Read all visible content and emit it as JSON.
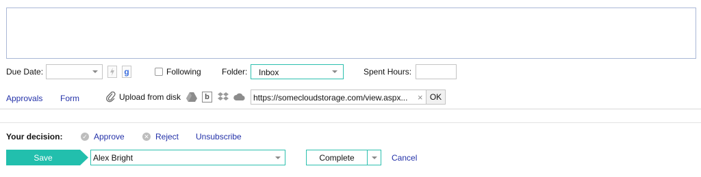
{
  "description_box": {
    "value": ""
  },
  "row1": {
    "due_date_label": "Due Date:",
    "due_date_value": "",
    "following_label": "Following",
    "folder_label": "Folder:",
    "folder_value": "Inbox",
    "spent_hours_label": "Spent Hours:",
    "spent_hours_value": ""
  },
  "row2": {
    "approvals_label": "Approvals",
    "form_label": "Form",
    "upload_label": "Upload from disk",
    "url_value": "https://somecloudstorage.com/view.aspx...",
    "clear_glyph": "×",
    "ok_label": "OK",
    "google_glyph": "g",
    "box_glyph": "b"
  },
  "decision": {
    "label": "Your decision:",
    "approve_label": "Approve",
    "reject_label": "Reject",
    "unsubscribe_label": "Unsubscribe"
  },
  "footer": {
    "save_label": "Save",
    "assignee_value": "Alex Bright",
    "complete_label": "Complete",
    "cancel_label": "Cancel"
  },
  "colors": {
    "accent": "#22bfad",
    "link": "#2230a8",
    "field_border": "#c4c4c4"
  }
}
